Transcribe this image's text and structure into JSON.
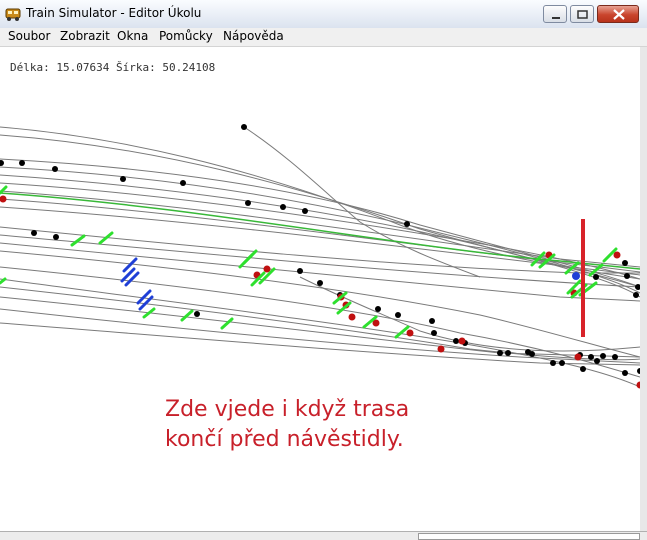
{
  "window": {
    "title": "Train Simulator - Editor Úkolu",
    "icon": "train-app-icon",
    "controls": [
      "minimize-icon",
      "maximize-icon",
      "close-icon"
    ]
  },
  "menu": {
    "items": [
      {
        "label": "Soubor"
      },
      {
        "label": "Zobrazit"
      },
      {
        "label": "Okna"
      },
      {
        "label": "Pomůcky"
      },
      {
        "label": "Nápověda"
      }
    ]
  },
  "canvas": {
    "coords_text": "Délka: 15.07634 Šírka: 50.24108",
    "annotation_line1": "Zde vjede i když trasa",
    "annotation_line2": "končí před návěstidly."
  },
  "colors": {
    "track": "#707070",
    "route": "#38b838",
    "node": "#000000",
    "signal_green": "#2ee02e",
    "signal_blue": "#1f3fd6",
    "signal_red": "#c01010",
    "marker_line": "#d8232a",
    "annotation": "#c8202a"
  }
}
